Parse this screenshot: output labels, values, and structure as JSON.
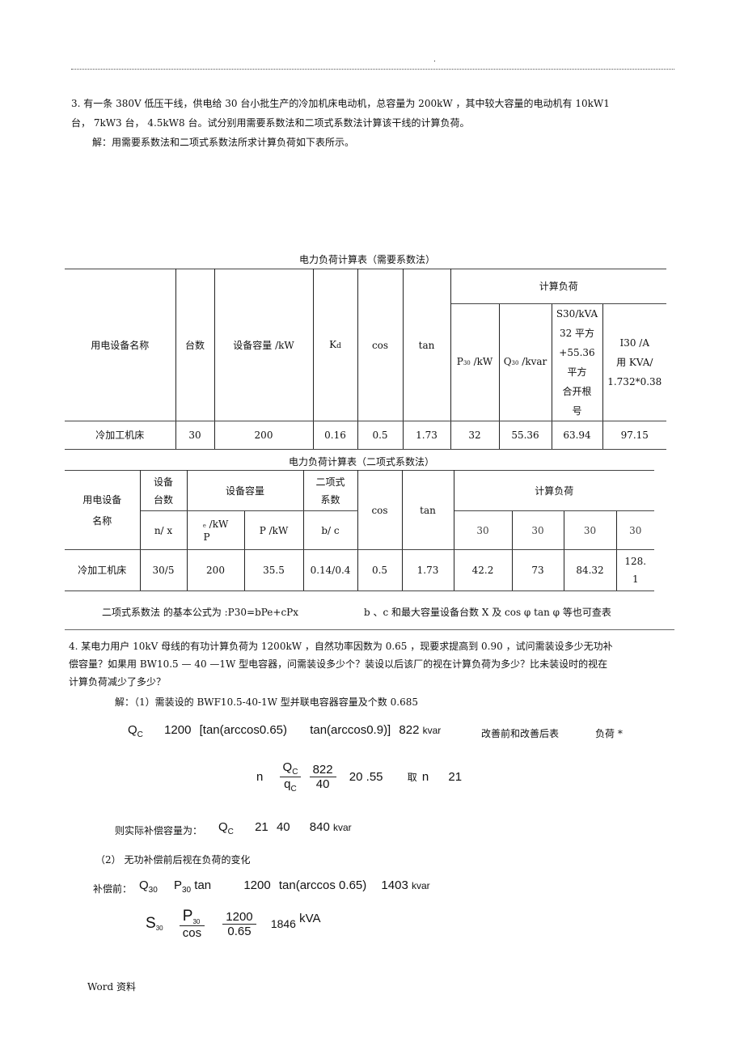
{
  "header": {
    "mark": "."
  },
  "problem3": {
    "line1": "3. 有一条  380V 低压干线，供电给    30 台小批生产的冷加机床电动机，总容量为     200kW ，其中较大容量的电动机有    10kW1",
    "line2": "台， 7kW3 台， 4.5kW8  台。试分别用需要系数法和二项式系数法计算该干线的计算负荷。",
    "solution_intro": "解：用需要系数法和二项式系数法所求计算负荷如下表所示。"
  },
  "table1": {
    "caption": "电力负荷计算表（需要系数法）",
    "headers": {
      "device_name": "用电设备名称",
      "count": "台数",
      "capacity": "设备容量 /kW",
      "kd": "K",
      "kd_sub": "d",
      "cos": "cos",
      "tan": "tan",
      "calc_load": "计算负荷",
      "p30": "P",
      "p30_sub": "30",
      "p30_unit": " /kW",
      "q30": "Q",
      "q30_sub": "30",
      "q30_unit": " /kvar",
      "s30_lines": [
        "S30/kVA",
        "32 平方",
        "+55.36",
        "平方",
        "合开根",
        "号"
      ],
      "i30_lines": [
        "I30 /A",
        "用 KVA/",
        "1.732*0.38"
      ]
    },
    "rows": [
      {
        "device_name": "冷加工机床",
        "count": "30",
        "capacity": "200",
        "kd": "0.16",
        "cos": "0.5",
        "tan": "1.73",
        "p30": "32",
        "q30": "55.36",
        "s30": "63.94",
        "i30": "97.15"
      }
    ]
  },
  "table2": {
    "caption": "电力负荷计算表（二项式系数法）",
    "headers": {
      "device_name_l1": "用电设备",
      "device_name_l2": "名称",
      "count_l1": "设备",
      "count_l2": "台数",
      "capacity": "设备容量",
      "coef_l1": "二项式",
      "coef_l2": "系数",
      "cos": "cos",
      "tan": "tan",
      "calc_load": "计算负荷",
      "nx": "n/ x",
      "pe_sub": "e",
      "pe_unit": " /kW",
      "pe_main": "P",
      "px": "P /kW",
      "bc": "b/ c",
      "calc_sub": [
        "30",
        "30",
        "30",
        "30"
      ]
    },
    "rows": [
      {
        "device_name": "冷加工机床",
        "nx": "30/5",
        "pe": "200",
        "px": "35.5",
        "bc": "0.14/0.4",
        "cos": "0.5",
        "tan": "1.73",
        "p30": "42.2",
        "q30": "73",
        "s30": "84.32",
        "i30_l1": "128.",
        "i30_l2": "1"
      }
    ],
    "footnote_left": "二项式系数法    的基本公式为 :P30=bPe+cPx",
    "footnote_right": "b 、c 和最大容量设备台数   X 及 cos φ tan  φ  等也可查表"
  },
  "problem4": {
    "line1": "4. 某电力用户  10kV     母线的有功计算负荷为     1200kW ，自然功率因数为     0.65 ，现要求提高到   0.90 ，试问需装设多少无功补",
    "line2": "偿容量？如果用  BW10.5 — 40 —1W   型电容器，问需装设多少个？装设以后该厂的视在计算负荷为多少？比未装设时的视在",
    "line3": "计算负荷减少了多少？",
    "step1": "解：（1）需装设的  BWF10.5-40-1W  型并联电容器容量及个数     0.685",
    "eq_qc": {
      "lhs": "Q",
      "lhs_sub": "C",
      "terms": [
        "1200",
        "[tan(arccos0.65)",
        "tan(arccos0.9)]",
        "822"
      ],
      "unit": "kvar",
      "note1": "改善前和改善后表",
      "note2": "负荷 *"
    },
    "eq_n": {
      "lhs": "n",
      "frac1_num": "Q",
      "frac1_num_sub": "C",
      "frac1_den": "q",
      "frac1_den_sub": "C",
      "frac2_num": "822",
      "frac2_den": "40",
      "result": "20 .55",
      "take_label": "取",
      "take_var": "n",
      "take_value": "21"
    },
    "actual": {
      "label": "则实际补偿容量为：",
      "lhs": "Q",
      "lhs_sub": "C",
      "terms": [
        "21",
        "40",
        "840"
      ],
      "unit": "kvar"
    },
    "step2": "（2）    无功补偿前后视在负荷的变化",
    "before": {
      "label": "补偿前：",
      "lhs": "Q",
      "lhs_sub": "30",
      "p": "P",
      "p_sub": "30",
      "p_tail": " tan",
      "terms": [
        "1200",
        "tan(arccos 0.65)",
        "1403"
      ],
      "unit": "kvar"
    },
    "eq_s30": {
      "lhs": "S",
      "lhs_sub": "30",
      "frac1_num": "P",
      "frac1_num_sub": "30",
      "frac1_den": "cos",
      "frac2_num": "1200",
      "frac2_den": "0.65",
      "result": "1846",
      "unit": "kVA"
    }
  },
  "footer": {
    "label": "Word 资料"
  }
}
